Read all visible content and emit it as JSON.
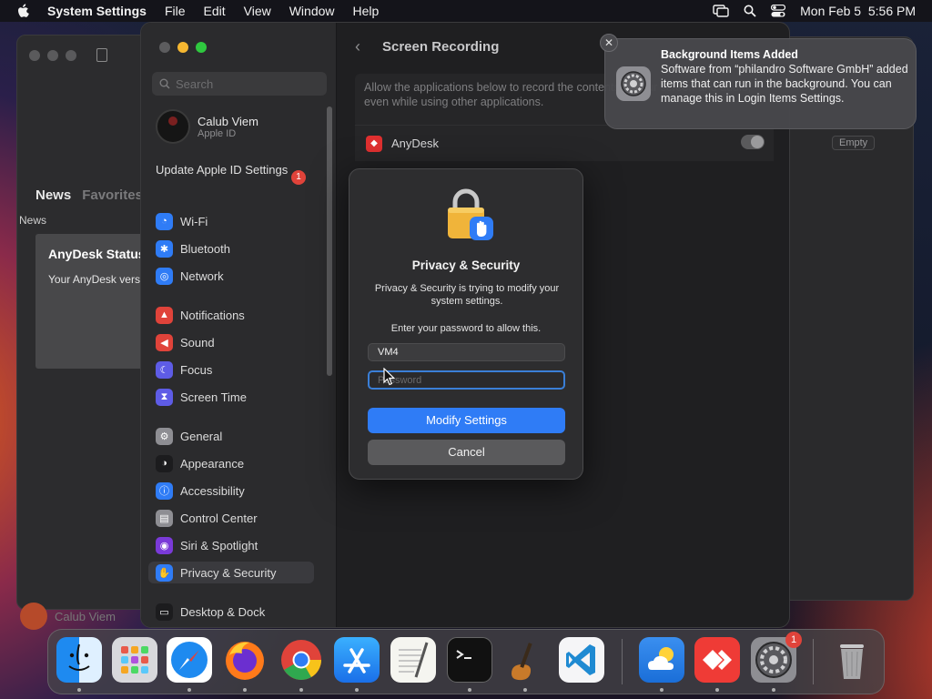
{
  "menubar": {
    "app_name": "System Settings",
    "menus": [
      "File",
      "Edit",
      "View",
      "Window",
      "Help"
    ],
    "date": "Mon Feb 5",
    "time": "5:56 PM"
  },
  "news_window": {
    "tab_news": "News",
    "tab_favorites": "Favorites",
    "section_label": "News",
    "card_title": "AnyDesk Status",
    "card_text": "Your AnyDesk version is up to date."
  },
  "dock_user": "Calub Viem",
  "settings": {
    "search_placeholder": "Search",
    "profile": {
      "name": "Calub Viem",
      "subtitle": "Apple ID"
    },
    "update": {
      "label": "Update Apple ID Settings",
      "badge": "1"
    },
    "sidebar_items": [
      {
        "label": "Wi-Fi",
        "icon": "wifi-icon",
        "color": "#2f7cf6"
      },
      {
        "label": "Bluetooth",
        "icon": "bluetooth-icon",
        "color": "#2f7cf6"
      },
      {
        "label": "Network",
        "icon": "globe-icon",
        "color": "#2f7cf6"
      },
      {
        "label": "Notifications",
        "icon": "bell-icon",
        "color": "#e0433a"
      },
      {
        "label": "Sound",
        "icon": "speaker-icon",
        "color": "#e0433a"
      },
      {
        "label": "Focus",
        "icon": "moon-icon",
        "color": "#5e5ce6"
      },
      {
        "label": "Screen Time",
        "icon": "hourglass-icon",
        "color": "#5e5ce6"
      },
      {
        "label": "General",
        "icon": "gear-icon",
        "color": "#8e8e93"
      },
      {
        "label": "Appearance",
        "icon": "appearance-icon",
        "color": "#1c1c1e"
      },
      {
        "label": "Accessibility",
        "icon": "accessibility-icon",
        "color": "#2f7cf6"
      },
      {
        "label": "Control Center",
        "icon": "control-center-icon",
        "color": "#8e8e93"
      },
      {
        "label": "Siri & Spotlight",
        "icon": "siri-icon",
        "color": "#7a3ad8"
      },
      {
        "label": "Privacy & Security",
        "icon": "hand-icon",
        "color": "#2f7cf6"
      },
      {
        "label": "Desktop & Dock",
        "icon": "dock-icon",
        "color": "#1c1c1e"
      }
    ],
    "content_title": "Screen Recording",
    "description": "Allow the applications below to record the contents of your screen and audio, even while using other applications.",
    "app_row": "AnyDesk",
    "empty_label": "Empty"
  },
  "dialog": {
    "title": "Privacy & Security",
    "message": "Privacy & Security is trying to modify your system settings.",
    "prompt": "Enter your password to allow this.",
    "username": "VM4",
    "password_placeholder": "Password",
    "primary_button": "Modify Settings",
    "cancel_button": "Cancel"
  },
  "notification": {
    "title": "Background Items Added",
    "body": "Software from “philandro Software GmbH” added items that can run in the background. You can manage this in Login Items Settings."
  },
  "dock": {
    "apps": [
      "Finder",
      "Launchpad",
      "Safari",
      "Firefox",
      "Chrome",
      "App Store",
      "TextEdit",
      "Terminal",
      "GarageBand",
      "Visual Studio Code",
      "Weather",
      "AnyDesk",
      "System Settings",
      "Trash"
    ],
    "settings_badge": "1"
  }
}
